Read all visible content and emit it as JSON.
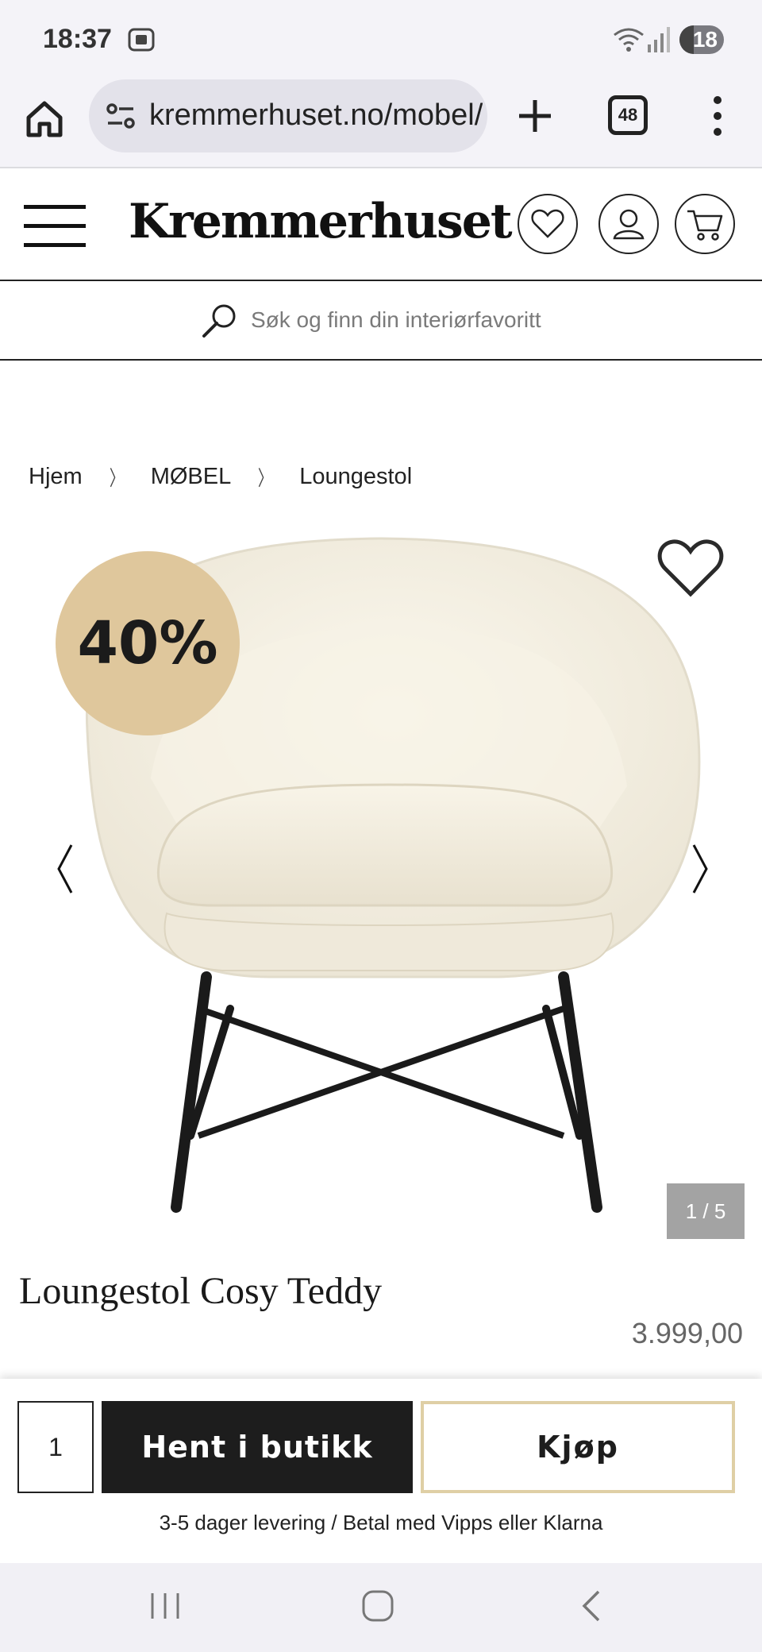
{
  "status_bar": {
    "time": "18:37",
    "battery": "18"
  },
  "browser": {
    "url": "kremmerhuset.no/mobel/lounge",
    "tab_count": "48"
  },
  "site": {
    "logo": "Kremmerhuset",
    "search_placeholder": "Søk og finn din interiørfavoritt"
  },
  "breadcrumb": {
    "items": [
      "Hjem",
      "MØBEL",
      "Loungestol"
    ],
    "separator": "〉"
  },
  "gallery": {
    "discount": "40%",
    "counter": "1 / 5"
  },
  "product": {
    "title": "Loungestol Cosy Teddy",
    "price": "3.999,00"
  },
  "purchase": {
    "quantity": "1",
    "pickup_label": "Hent i butikk",
    "buy_label": "Kjøp",
    "delivery_info": "3-5 dager levering / Betal med Vipps eller Klarna"
  },
  "colors": {
    "discount_badge": "#dfc79c",
    "buy_border": "#dfcfa5",
    "pickup_bg": "#1d1d1d"
  }
}
